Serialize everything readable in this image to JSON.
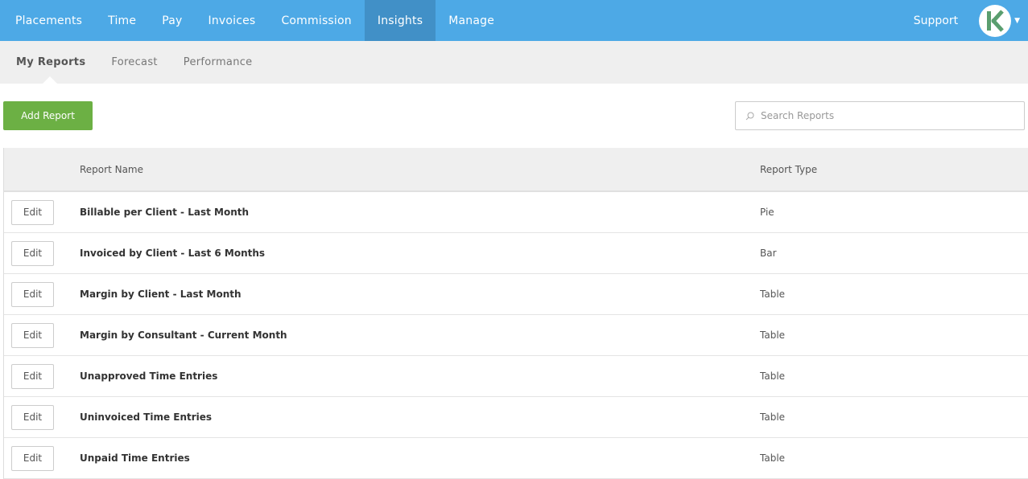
{
  "topnav": {
    "items": [
      {
        "label": "Placements",
        "active": false
      },
      {
        "label": "Time",
        "active": false
      },
      {
        "label": "Pay",
        "active": false
      },
      {
        "label": "Invoices",
        "active": false
      },
      {
        "label": "Commission",
        "active": false
      },
      {
        "label": "Insights",
        "active": true
      },
      {
        "label": "Manage",
        "active": false
      }
    ],
    "support_label": "Support",
    "avatar_icon": "k-logo-icon",
    "brand_color": "#5a9e6f"
  },
  "subnav": {
    "items": [
      {
        "label": "My Reports",
        "active": true
      },
      {
        "label": "Forecast",
        "active": false
      },
      {
        "label": "Performance",
        "active": false
      }
    ]
  },
  "toolbar": {
    "add_report_label": "Add Report",
    "search_placeholder": "Search Reports",
    "search_value": ""
  },
  "table": {
    "headers": {
      "name": "Report Name",
      "type": "Report Type"
    },
    "edit_label": "Edit",
    "rows": [
      {
        "name": "Billable per Client - Last Month",
        "type": "Pie"
      },
      {
        "name": "Invoiced by Client - Last 6 Months",
        "type": "Bar"
      },
      {
        "name": "Margin by Client - Last Month",
        "type": "Table"
      },
      {
        "name": "Margin by Consultant - Current Month",
        "type": "Table"
      },
      {
        "name": "Unapproved Time Entries",
        "type": "Table"
      },
      {
        "name": "Uninvoiced Time Entries",
        "type": "Table"
      },
      {
        "name": "Unpaid Time Entries",
        "type": "Table"
      }
    ]
  }
}
